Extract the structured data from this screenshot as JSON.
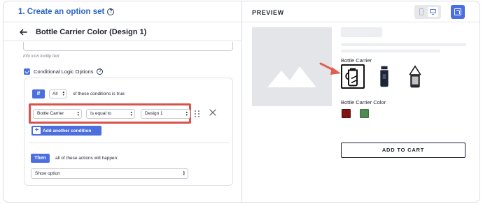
{
  "left_panel": {
    "step_title": "1. Create an option set",
    "subheader_title": "Bottle Carrier Color (Design 1)",
    "hint_text": "Info icon tooltip text",
    "conditional_logic_label": "Conditional Logic Options",
    "conditional_logic_checked": true,
    "if_label": "If",
    "match_select": "All",
    "conditions_text": "of these conditions is true:",
    "condition": {
      "field": "Bottle Carrier",
      "operator": "Is equal to",
      "value": "Design 1"
    },
    "add_condition_label": "Add another condition",
    "then_label": "Then",
    "actions_text": "all of these actions will happen:",
    "action_select": "Show option"
  },
  "right_panel": {
    "preview_label": "PREVIEW",
    "option1_label": "Bottle Carrier",
    "option2_label": "Bottle Carrier Color",
    "colors": [
      "#7e1512",
      "#4f8a52"
    ],
    "add_to_cart_label": "ADD TO CART"
  },
  "accent_color": "#4c6fe0",
  "highlight_color": "#d9534b"
}
